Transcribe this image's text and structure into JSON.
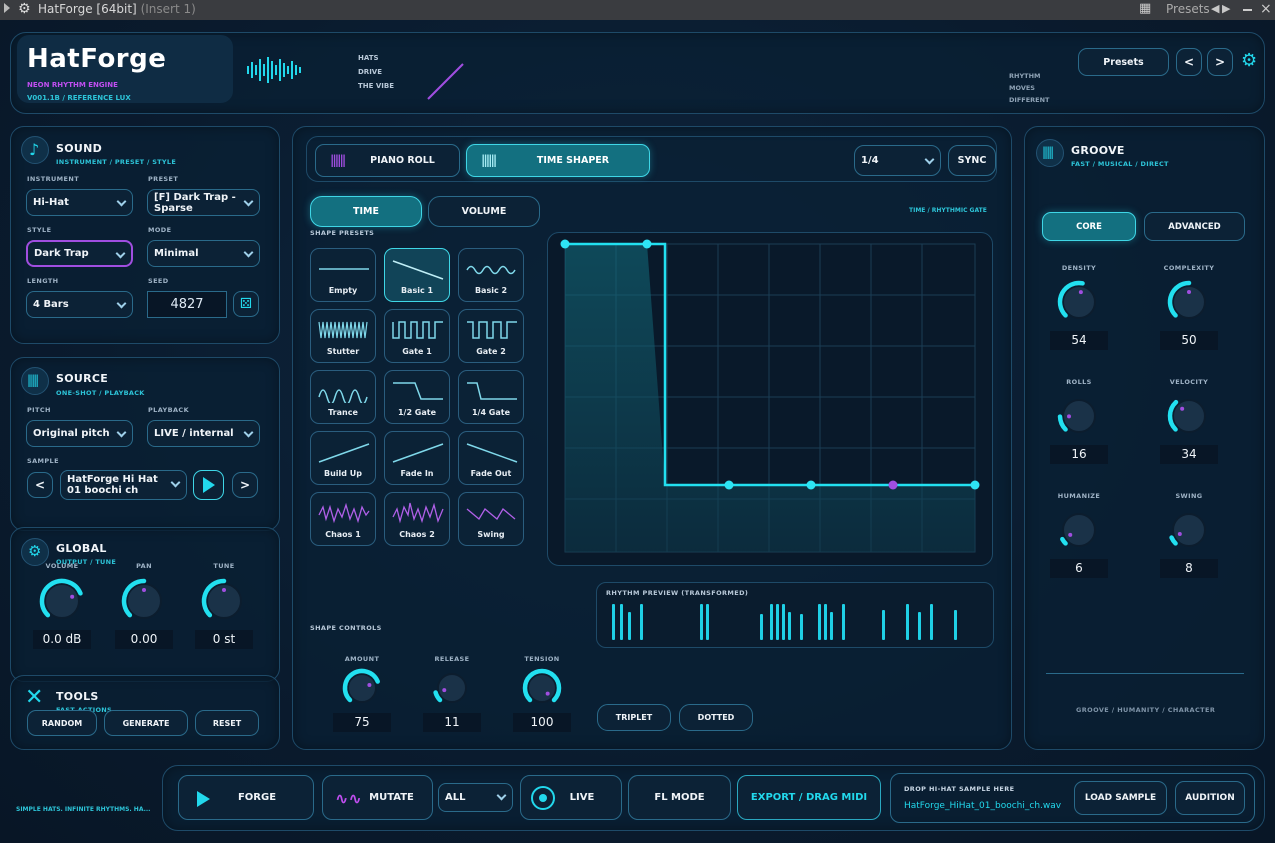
{
  "titlebar": {
    "app": "HatForge [64bit]",
    "insert": "(Insert 1)",
    "presets": "Presets"
  },
  "header": {
    "logo": "HatForge",
    "tagline": "NEON RHYTHM ENGINE",
    "version": "V001.1B  /  REFERENCE LUX",
    "words": [
      "HATS",
      "DRIVE",
      "THE VIBE"
    ],
    "right_words": [
      "RHYTHM",
      "MOVES",
      "DIFFERENT"
    ],
    "presets_button": "Presets",
    "prev": "<",
    "next": ">"
  },
  "sound": {
    "title": "SOUND",
    "subtitle": "INSTRUMENT / PRESET / STYLE",
    "instrument_label": "INSTRUMENT",
    "instrument": "Hi-Hat",
    "preset_label": "PRESET",
    "preset": "[F] Dark Trap - Sparse",
    "style_label": "STYLE",
    "style": "Dark Trap",
    "mode_label": "MODE",
    "mode": "Minimal",
    "length_label": "LENGTH",
    "length": "4 Bars",
    "seed_label": "SEED",
    "seed": "4827"
  },
  "source": {
    "title": "SOURCE",
    "subtitle": "ONE-SHOT / PLAYBACK",
    "pitch_label": "PITCH",
    "pitch": "Original pitch",
    "playback_label": "PLAYBACK",
    "playback": "LIVE / internal",
    "sample_label": "SAMPLE",
    "sample": "HatForge Hi Hat 01 boochi ch",
    "prev": "<",
    "next": ">"
  },
  "global": {
    "title": "GLOBAL",
    "subtitle": "OUTPUT / TUNE",
    "knobs": [
      {
        "label": "VOLUME",
        "value": "0.0 dB",
        "level": 0.75
      },
      {
        "label": "PAN",
        "value": "0.00",
        "level": 0.5
      },
      {
        "label": "TUNE",
        "value": "0 st",
        "level": 0.5
      }
    ]
  },
  "tools": {
    "title": "TOOLS",
    "subtitle": "FAST ACTIONS",
    "buttons": [
      "RANDOM",
      "GENERATE",
      "RESET"
    ]
  },
  "center": {
    "tabs": [
      "PIANO ROLL",
      "TIME SHAPER"
    ],
    "active_tab": "TIME SHAPER",
    "division": "1/4",
    "sync": "SYNC",
    "mode_tabs": [
      "TIME",
      "VOLUME"
    ],
    "active_mode": "TIME",
    "graph_caption": "TIME / RHYTHMIC GATE",
    "shape_presets_label": "SHAPE PRESETS",
    "presets": [
      "Empty",
      "Basic 1",
      "Basic 2",
      "Stutter",
      "Gate 1",
      "Gate 2",
      "Trance",
      "1/2 Gate",
      "1/4 Gate",
      "Build Up",
      "Fade In",
      "Fade Out",
      "Chaos 1",
      "Chaos 2",
      "Swing"
    ],
    "active_preset": "Basic 1",
    "shape_controls_label": "SHAPE CONTROLS",
    "shape_knobs": [
      {
        "label": "AMOUNT",
        "value": "75",
        "level": 0.75
      },
      {
        "label": "RELEASE",
        "value": "11",
        "level": 0.11
      },
      {
        "label": "TENSION",
        "value": "100",
        "level": 1.0
      }
    ],
    "rhythm_preview_label": "RHYTHM PREVIEW (TRANSFORMED)",
    "triplet": "TRIPLET",
    "dotted": "DOTTED"
  },
  "groove": {
    "title": "GROOVE",
    "subtitle": "FAST / MUSICAL / DIRECT",
    "tabs": [
      "CORE",
      "ADVANCED"
    ],
    "active_tab": "CORE",
    "knobs": [
      {
        "label": "DENSITY",
        "value": "54",
        "level": 0.54
      },
      {
        "label": "COMPLEXITY",
        "value": "50",
        "level": 0.5
      },
      {
        "label": "ROLLS",
        "value": "16",
        "level": 0.16
      },
      {
        "label": "VELOCITY",
        "value": "34",
        "level": 0.34
      },
      {
        "label": "HUMANIZE",
        "value": "6",
        "level": 0.06
      },
      {
        "label": "SWING",
        "value": "8",
        "level": 0.08
      }
    ],
    "footer": "GROOVE  /  HUMANITY  /  CHARACTER"
  },
  "bottom": {
    "slogan": "SIMPLE HATS. INFINITE RHYTHMS. HA...",
    "forge": "FORGE",
    "mutate": "MUTATE",
    "scope": "ALL",
    "live": "LIVE",
    "fl_mode": "FL MODE",
    "export": "EXPORT / DRAG MIDI",
    "drop_label": "DROP HI-HAT SAMPLE HERE",
    "file": "HatForge_HiHat_01_boochi_ch.wav",
    "load": "LOAD SAMPLE",
    "audition": "AUDITION"
  },
  "colors": {
    "accent": "#22d8ec",
    "purple": "#a04ee0",
    "bg": "#0a1a2c"
  }
}
